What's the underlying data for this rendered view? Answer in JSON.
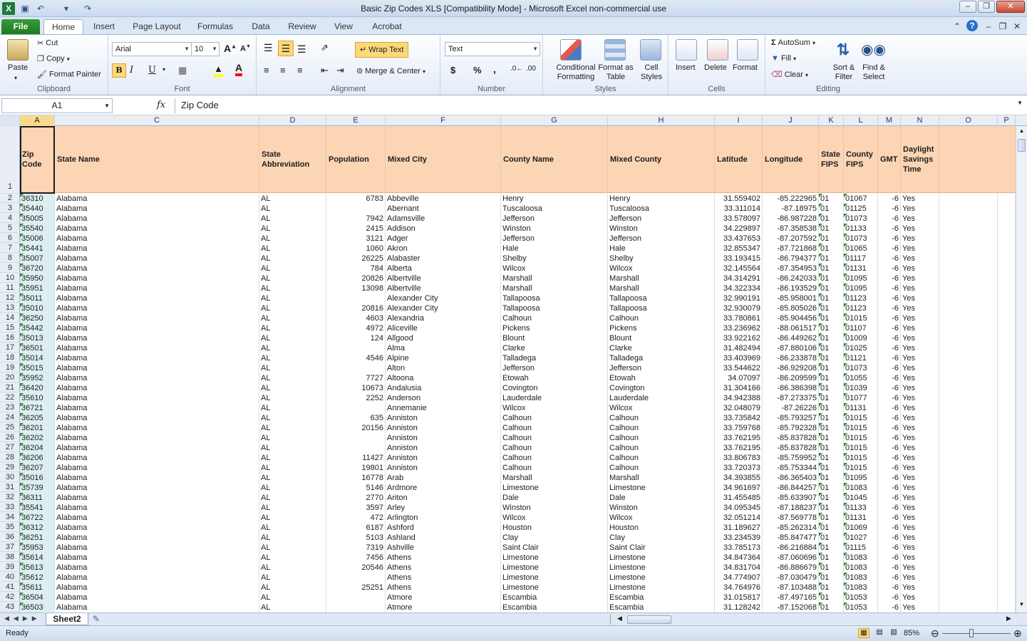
{
  "window": {
    "title": "Basic Zip Codes XLS  [Compatibility Mode]  -  Microsoft Excel non-commercial use"
  },
  "ribbon_tabs": [
    "File",
    "Home",
    "Insert",
    "Page Layout",
    "Formulas",
    "Data",
    "Review",
    "View",
    "Acrobat"
  ],
  "clipboard": {
    "paste": "Paste",
    "cut": "Cut",
    "copy": "Copy",
    "format_painter": "Format Painter",
    "label": "Clipboard"
  },
  "font": {
    "name": "Arial",
    "size": "10",
    "label": "Font",
    "bold": "B",
    "italic": "I",
    "underline": "U"
  },
  "alignment": {
    "wrap_text": "Wrap Text",
    "merge_center": "Merge & Center",
    "label": "Alignment"
  },
  "number": {
    "format": "Text",
    "currency": "$",
    "percent": "%",
    "comma": ",",
    "label": "Number"
  },
  "styles": {
    "conditional": "Conditional Formatting",
    "format_table": "Format as Table",
    "cell_styles": "Cell Styles",
    "label": "Styles"
  },
  "cells": {
    "insert": "Insert",
    "delete": "Delete",
    "format": "Format",
    "label": "Cells"
  },
  "editing": {
    "autosum": "AutoSum",
    "fill": "Fill",
    "clear": "Clear",
    "sort": "Sort & Filter",
    "find": "Find & Select",
    "label": "Editing"
  },
  "formula_bar": {
    "name_box": "A1",
    "fx": "fx",
    "formula": "Zip Code"
  },
  "column_letters": [
    "A",
    "C",
    "D",
    "E",
    "F",
    "G",
    "H",
    "I",
    "J",
    "K",
    "L",
    "M",
    "N",
    "O",
    "P"
  ],
  "headers": [
    "Zip Code",
    "State Name",
    "State Abbreviation",
    "Population",
    "Mixed City",
    "County Name",
    "Mixed County",
    "Latitude",
    "Longitude",
    "State FIPS",
    "County FIPS",
    "GMT",
    "Daylight Savings Time"
  ],
  "rows": [
    [
      "36310",
      "Alabama",
      "AL",
      "6783",
      "Abbeville",
      "Henry",
      "Henry",
      "31.559402",
      "-85.222965",
      "01",
      "01067",
      "-6",
      "Yes"
    ],
    [
      "35440",
      "Alabama",
      "AL",
      "",
      "Abernant",
      "Tuscaloosa",
      "Tuscaloosa",
      "33.311014",
      "-87.18975",
      "01",
      "01125",
      "-6",
      "Yes"
    ],
    [
      "35005",
      "Alabama",
      "AL",
      "7942",
      "Adamsville",
      "Jefferson",
      "Jefferson",
      "33.578097",
      "-86.987228",
      "01",
      "01073",
      "-6",
      "Yes"
    ],
    [
      "35540",
      "Alabama",
      "AL",
      "2415",
      "Addison",
      "Winston",
      "Winston",
      "34.229897",
      "-87.358538",
      "01",
      "01133",
      "-6",
      "Yes"
    ],
    [
      "35006",
      "Alabama",
      "AL",
      "3121",
      "Adger",
      "Jefferson",
      "Jefferson",
      "33.437653",
      "-87.207592",
      "01",
      "01073",
      "-6",
      "Yes"
    ],
    [
      "35441",
      "Alabama",
      "AL",
      "1060",
      "Akron",
      "Hale",
      "Hale",
      "32.855347",
      "-87.721868",
      "01",
      "01065",
      "-6",
      "Yes"
    ],
    [
      "35007",
      "Alabama",
      "AL",
      "26225",
      "Alabaster",
      "Shelby",
      "Shelby",
      "33.193415",
      "-86.794377",
      "01",
      "01117",
      "-6",
      "Yes"
    ],
    [
      "36720",
      "Alabama",
      "AL",
      "784",
      "Alberta",
      "Wilcox",
      "Wilcox",
      "32.145564",
      "-87.354953",
      "01",
      "01131",
      "-6",
      "Yes"
    ],
    [
      "35950",
      "Alabama",
      "AL",
      "20826",
      "Albertville",
      "Marshall",
      "Marshall",
      "34.314291",
      "-86.242033",
      "01",
      "01095",
      "-6",
      "Yes"
    ],
    [
      "35951",
      "Alabama",
      "AL",
      "13098",
      "Albertville",
      "Marshall",
      "Marshall",
      "34.322334",
      "-86.193529",
      "01",
      "01095",
      "-6",
      "Yes"
    ],
    [
      "35011",
      "Alabama",
      "AL",
      "",
      "Alexander City",
      "Tallapoosa",
      "Tallapoosa",
      "32.990191",
      "-85.958001",
      "01",
      "01123",
      "-6",
      "Yes"
    ],
    [
      "35010",
      "Alabama",
      "AL",
      "20816",
      "Alexander City",
      "Tallapoosa",
      "Tallapoosa",
      "32.930079",
      "-85.805026",
      "01",
      "01123",
      "-6",
      "Yes"
    ],
    [
      "36250",
      "Alabama",
      "AL",
      "4603",
      "Alexandria",
      "Calhoun",
      "Calhoun",
      "33.780861",
      "-85.904456",
      "01",
      "01015",
      "-6",
      "Yes"
    ],
    [
      "35442",
      "Alabama",
      "AL",
      "4972",
      "Aliceville",
      "Pickens",
      "Pickens",
      "33.236962",
      "-88.061517",
      "01",
      "01107",
      "-6",
      "Yes"
    ],
    [
      "35013",
      "Alabama",
      "AL",
      "124",
      "Allgood",
      "Blount",
      "Blount",
      "33.922162",
      "-86.449262",
      "01",
      "01009",
      "-6",
      "Yes"
    ],
    [
      "36501",
      "Alabama",
      "AL",
      "",
      "Alma",
      "Clarke",
      "Clarke",
      "31.482494",
      "-87.880106",
      "01",
      "01025",
      "-6",
      "Yes"
    ],
    [
      "35014",
      "Alabama",
      "AL",
      "4546",
      "Alpine",
      "Talladega",
      "Talladega",
      "33.403969",
      "-86.233878",
      "01",
      "01121",
      "-6",
      "Yes"
    ],
    [
      "35015",
      "Alabama",
      "AL",
      "",
      "Alton",
      "Jefferson",
      "Jefferson",
      "33.544622",
      "-86.929208",
      "01",
      "01073",
      "-6",
      "Yes"
    ],
    [
      "35952",
      "Alabama",
      "AL",
      "7727",
      "Altoona",
      "Etowah",
      "Etowah",
      "34.07097",
      "-86.209599",
      "01",
      "01055",
      "-6",
      "Yes"
    ],
    [
      "36420",
      "Alabama",
      "AL",
      "10673",
      "Andalusia",
      "Covington",
      "Covington",
      "31.304166",
      "-86.386398",
      "01",
      "01039",
      "-6",
      "Yes"
    ],
    [
      "35610",
      "Alabama",
      "AL",
      "2252",
      "Anderson",
      "Lauderdale",
      "Lauderdale",
      "34.942388",
      "-87.273375",
      "01",
      "01077",
      "-6",
      "Yes"
    ],
    [
      "36721",
      "Alabama",
      "AL",
      "",
      "Annemanie",
      "Wilcox",
      "Wilcox",
      "32.048079",
      "-87.26226",
      "01",
      "01131",
      "-6",
      "Yes"
    ],
    [
      "36205",
      "Alabama",
      "AL",
      "635",
      "Anniston",
      "Calhoun",
      "Calhoun",
      "33.735842",
      "-85.793257",
      "01",
      "01015",
      "-6",
      "Yes"
    ],
    [
      "36201",
      "Alabama",
      "AL",
      "20156",
      "Anniston",
      "Calhoun",
      "Calhoun",
      "33.759768",
      "-85.792328",
      "01",
      "01015",
      "-6",
      "Yes"
    ],
    [
      "36202",
      "Alabama",
      "AL",
      "",
      "Anniston",
      "Calhoun",
      "Calhoun",
      "33.762195",
      "-85.837828",
      "01",
      "01015",
      "-6",
      "Yes"
    ],
    [
      "36204",
      "Alabama",
      "AL",
      "",
      "Anniston",
      "Calhoun",
      "Calhoun",
      "33.762195",
      "-85.837828",
      "01",
      "01015",
      "-6",
      "Yes"
    ],
    [
      "36206",
      "Alabama",
      "AL",
      "11427",
      "Anniston",
      "Calhoun",
      "Calhoun",
      "33.806783",
      "-85.759952",
      "01",
      "01015",
      "-6",
      "Yes"
    ],
    [
      "36207",
      "Alabama",
      "AL",
      "19801",
      "Anniston",
      "Calhoun",
      "Calhoun",
      "33.720373",
      "-85.753344",
      "01",
      "01015",
      "-6",
      "Yes"
    ],
    [
      "35016",
      "Alabama",
      "AL",
      "16778",
      "Arab",
      "Marshall",
      "Marshall",
      "34.393855",
      "-86.365403",
      "01",
      "01095",
      "-6",
      "Yes"
    ],
    [
      "35739",
      "Alabama",
      "AL",
      "5146",
      "Ardmore",
      "Limestone",
      "Limestone",
      "34.961697",
      "-86.844257",
      "01",
      "01083",
      "-6",
      "Yes"
    ],
    [
      "36311",
      "Alabama",
      "AL",
      "2770",
      "Ariton",
      "Dale",
      "Dale",
      "31.455485",
      "-85.633907",
      "01",
      "01045",
      "-6",
      "Yes"
    ],
    [
      "35541",
      "Alabama",
      "AL",
      "3597",
      "Arley",
      "Winston",
      "Winston",
      "34.095345",
      "-87.188237",
      "01",
      "01133",
      "-6",
      "Yes"
    ],
    [
      "36722",
      "Alabama",
      "AL",
      "472",
      "Arlington",
      "Wilcox",
      "Wilcox",
      "32.051214",
      "-87.569778",
      "01",
      "01131",
      "-6",
      "Yes"
    ],
    [
      "36312",
      "Alabama",
      "AL",
      "6187",
      "Ashford",
      "Houston",
      "Houston",
      "31.189627",
      "-85.262314",
      "01",
      "01069",
      "-6",
      "Yes"
    ],
    [
      "36251",
      "Alabama",
      "AL",
      "5103",
      "Ashland",
      "Clay",
      "Clay",
      "33.234539",
      "-85.847477",
      "01",
      "01027",
      "-6",
      "Yes"
    ],
    [
      "35953",
      "Alabama",
      "AL",
      "7319",
      "Ashville",
      "Saint Clair",
      "Saint Clair",
      "33.785173",
      "-86.216884",
      "01",
      "01115",
      "-6",
      "Yes"
    ],
    [
      "35614",
      "Alabama",
      "AL",
      "7456",
      "Athens",
      "Limestone",
      "Limestone",
      "34.847364",
      "-87.060696",
      "01",
      "01083",
      "-6",
      "Yes"
    ],
    [
      "35613",
      "Alabama",
      "AL",
      "20546",
      "Athens",
      "Limestone",
      "Limestone",
      "34.831704",
      "-86.886679",
      "01",
      "01083",
      "-6",
      "Yes"
    ],
    [
      "35612",
      "Alabama",
      "AL",
      "",
      "Athens",
      "Limestone",
      "Limestone",
      "34.774907",
      "-87.030479",
      "01",
      "01083",
      "-6",
      "Yes"
    ],
    [
      "35611",
      "Alabama",
      "AL",
      "25251",
      "Athens",
      "Limestone",
      "Limestone",
      "34.764976",
      "-87.103488",
      "01",
      "01083",
      "-6",
      "Yes"
    ],
    [
      "36504",
      "Alabama",
      "AL",
      "",
      "Atmore",
      "Escambia",
      "Escambia",
      "31.015817",
      "-87.497165",
      "01",
      "01053",
      "-6",
      "Yes"
    ],
    [
      "36503",
      "Alabama",
      "AL",
      "",
      "Atmore",
      "Escambia",
      "Escambia",
      "31.128242",
      "-87.152068",
      "01",
      "01053",
      "-6",
      "Yes"
    ]
  ],
  "sheet_tab": "Sheet2",
  "status": {
    "ready": "Ready",
    "zoom": "85%"
  },
  "colors": {
    "header_fill": "#fcd5b4",
    "selected_col": "#f9d98c",
    "zip_fill": "#ddeef0",
    "text_indicator": "#2e8b2e"
  }
}
